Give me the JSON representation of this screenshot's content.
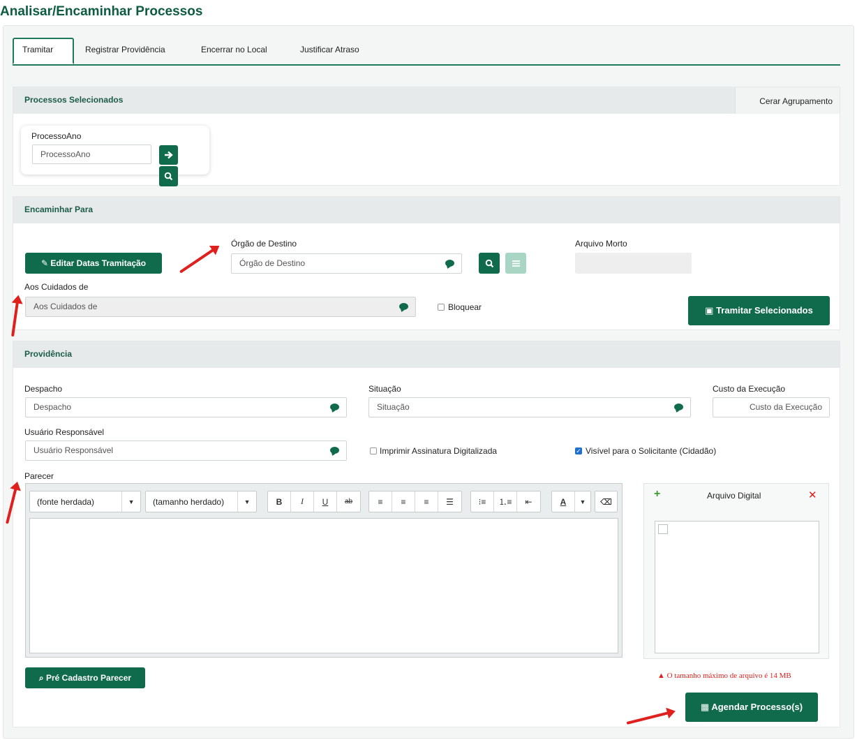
{
  "page_title": "Analisar/Encaminhar Processos",
  "tabs": [
    {
      "label": "Tramitar",
      "active": true
    },
    {
      "label": "Registrar Providência"
    },
    {
      "label": "Encerrar no Local"
    },
    {
      "label": "Justificar Atraso"
    }
  ],
  "processos": {
    "header": "Processos Selecionados",
    "action": "Cerar Agrupamento",
    "field_label": "ProcessoAno",
    "field_placeholder": "ProcessoAno"
  },
  "encaminhar": {
    "header": "Encaminhar Para",
    "editar_datas": "Editar Datas Tramitação",
    "orgao_label": "Órgão de Destino",
    "orgao_placeholder": "Órgão de Destino",
    "arquivo_morto_label": "Arquivo Morto",
    "cuidados_label": "Aos Cuidados de",
    "cuidados_placeholder": "Aos Cuidados de",
    "bloquear_label": "Bloquear",
    "tramitar_button": "Tramitar Selecionados"
  },
  "providencia": {
    "header": "Providência",
    "despacho_label": "Despacho",
    "despacho_placeholder": "Despacho",
    "situacao_label": "Situação",
    "situacao_placeholder": "Situação",
    "custo_label": "Custo da Execução",
    "custo_placeholder": "Custo da Execução",
    "usuario_label": "Usuário Responsável",
    "usuario_placeholder": "Usuário Responsável",
    "imprimir_label": "Imprimir Assinatura Digitalizada",
    "imprimir_checked": false,
    "visivel_label": "Visível para o Solicitante (Cidadão)",
    "visivel_checked": true,
    "parecer_label": "Parecer",
    "font_select": "(fonte herdada)",
    "size_select": "(tamanho herdado)",
    "pre_cadastro_button": "Pré Cadastro Parecer",
    "arquivo_digital_title": "Arquivo Digital",
    "max_size_warning": "O tamanho máximo de arquivo é 14 MB",
    "agendar_button": "Agendar Processo(s)"
  },
  "colors": {
    "brand": "#106b4d",
    "title": "#0d5c42",
    "annotation_arrow": "#e0201c",
    "warning": "#e0201c",
    "checkbox_checked": "#1e6fd0"
  }
}
